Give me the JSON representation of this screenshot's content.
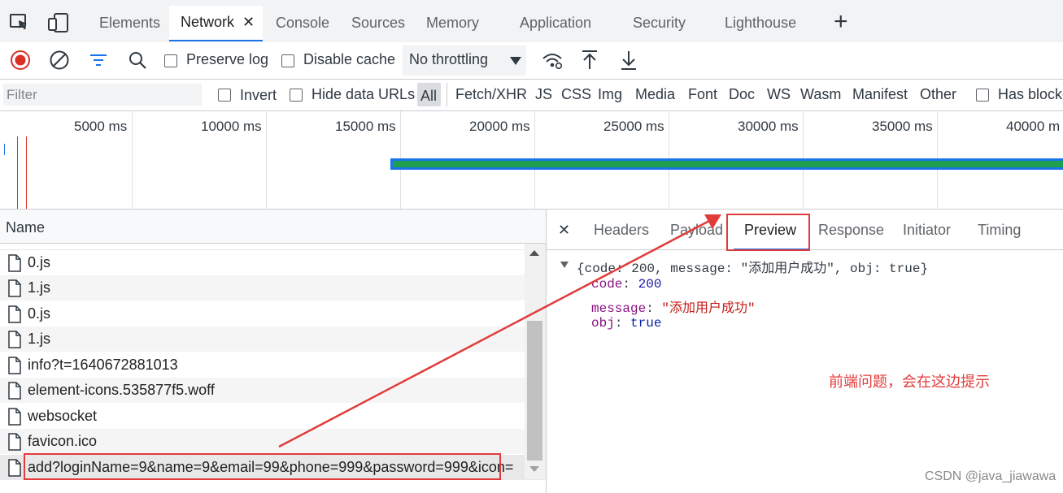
{
  "devtools": {
    "tabs": [
      {
        "label": "Elements"
      },
      {
        "label": "Network"
      },
      {
        "label": "Console"
      },
      {
        "label": "Sources"
      },
      {
        "label": "Memory"
      },
      {
        "label": "Application"
      },
      {
        "label": "Security"
      },
      {
        "label": "Lighthouse"
      }
    ],
    "active_tab": "Network",
    "close_glyph": "✕",
    "add_tab_glyph": "+"
  },
  "toolbar": {
    "preserve_log_label": "Preserve log",
    "disable_cache_label": "Disable cache",
    "throttling_value": "No throttling"
  },
  "filterbar": {
    "filter_placeholder": "Filter",
    "invert_label": "Invert",
    "hide_data_urls_label": "Hide data URLs",
    "types": [
      "All",
      "Fetch/XHR",
      "JS",
      "CSS",
      "Img",
      "Media",
      "Font",
      "Doc",
      "WS",
      "Wasm",
      "Manifest",
      "Other"
    ],
    "active_type": "All",
    "has_blocked_label": "Has blocke"
  },
  "timeline": {
    "ticks": [
      "5000 ms",
      "10000 ms",
      "15000 ms",
      "20000 ms",
      "25000 ms",
      "30000 ms",
      "35000 ms",
      "40000 m"
    ]
  },
  "requests": {
    "header": "Name",
    "rows": [
      {
        "name": "0.js"
      },
      {
        "name": "1.js"
      },
      {
        "name": "0.js"
      },
      {
        "name": "1.js"
      },
      {
        "name": "info?t=1640672881013"
      },
      {
        "name": "element-icons.535877f5.woff"
      },
      {
        "name": "websocket"
      },
      {
        "name": "favicon.ico"
      },
      {
        "name": "add?loginName=9&name=9&email=99&phone=999&password=999&icon="
      }
    ]
  },
  "details": {
    "close_glyph": "✕",
    "tabs": [
      "Headers",
      "Payload",
      "Preview",
      "Response",
      "Initiator",
      "Timing"
    ],
    "active_tab": "Preview",
    "preview": {
      "summary": "{code: 200, message: \"添加用户成功\", obj: true}",
      "code_key": "code",
      "code_value": "200",
      "message_key": "message",
      "message_value": "\"添加用户成功\"",
      "obj_key": "obj",
      "obj_value": "true"
    }
  },
  "annotation": {
    "note": "前端问题，会在这边提示",
    "color": "#e23b3b"
  },
  "watermark": "CSDN @java_jiawawa"
}
